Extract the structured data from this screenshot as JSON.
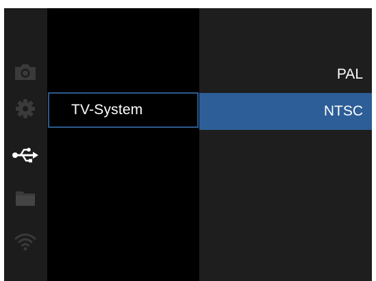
{
  "rail": {
    "icons": [
      {
        "name": "camera-icon",
        "state": "inactive"
      },
      {
        "name": "gear-icon",
        "state": "inactive"
      },
      {
        "name": "usb-icon",
        "state": "active"
      },
      {
        "name": "folder-icon",
        "state": "inactive"
      },
      {
        "name": "wifi-icon",
        "state": "inactive"
      }
    ]
  },
  "menu": {
    "selected_item": "TV-System"
  },
  "options": [
    {
      "label": "PAL",
      "selected": false
    },
    {
      "label": "NTSC",
      "selected": true
    }
  ],
  "colors": {
    "rail_background": "#1c1c1c",
    "panel_background": "#000000",
    "options_background": "#1e1e1e",
    "highlight": "#2d5e98",
    "focus_border": "#2d5a8e",
    "active_icon": "#ffffff",
    "inactive_icon": "#3a3a3a",
    "text": "#ffffff"
  }
}
